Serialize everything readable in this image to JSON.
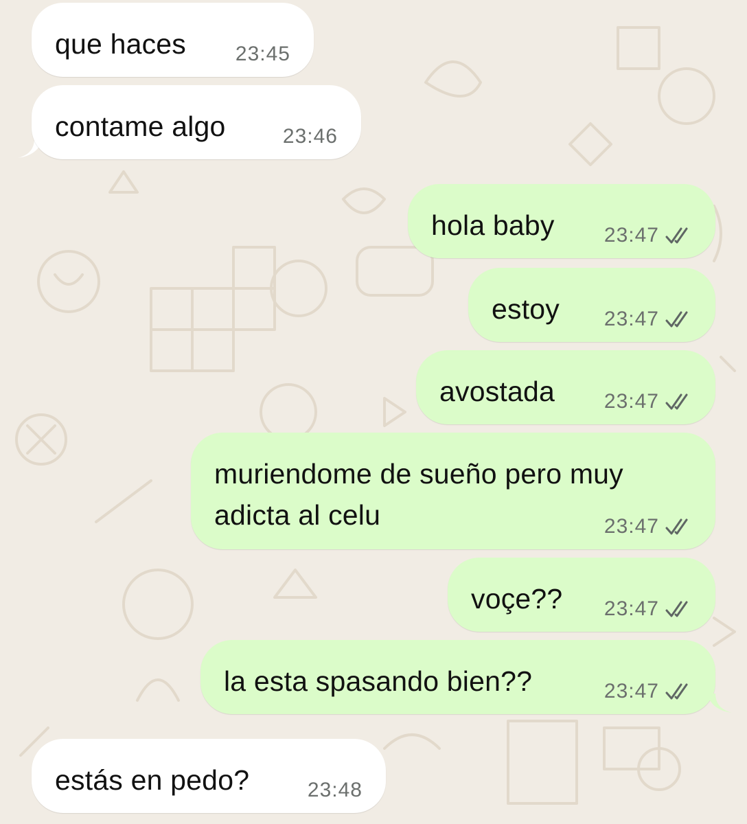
{
  "conversation": {
    "messages": [
      {
        "direction": "in",
        "text": "que haces",
        "time": "23:45"
      },
      {
        "direction": "in",
        "text": "contame algo",
        "time": "23:46"
      },
      {
        "direction": "out",
        "text": "hola baby",
        "time": "23:47",
        "status_icon": "double-check-icon"
      },
      {
        "direction": "out",
        "text": "estoy",
        "time": "23:47",
        "status_icon": "double-check-icon"
      },
      {
        "direction": "out",
        "text": "avostada",
        "time": "23:47",
        "status_icon": "double-check-icon"
      },
      {
        "direction": "out",
        "text": "muriendome de sueño pero muy\nadicta al celu",
        "time": "23:47",
        "status_icon": "double-check-icon"
      },
      {
        "direction": "out",
        "text": "voçe??",
        "time": "23:47",
        "status_icon": "double-check-icon"
      },
      {
        "direction": "out",
        "text": "la esta spasando bien??",
        "time": "23:47",
        "status_icon": "double-check-icon"
      },
      {
        "direction": "in",
        "text": "estás en pedo?",
        "time": "23:48"
      }
    ]
  },
  "colors": {
    "wallpaper": "#f1ece4",
    "incoming_bubble": "#ffffff",
    "outgoing_bubble": "#dbfcc9",
    "doodle_stroke": "#e4dccf",
    "time_text": "#6b6f6d"
  }
}
